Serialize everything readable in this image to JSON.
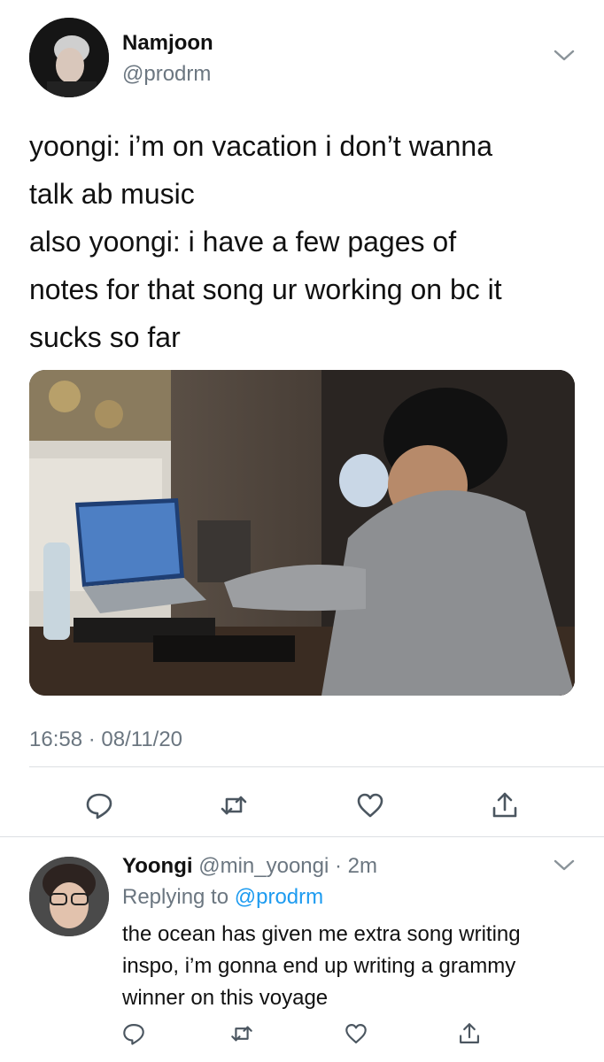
{
  "tweet": {
    "display_name": "Namjoon",
    "handle": "@prodrm",
    "text": "yoongi: i’m on vacation i don’t wanna\ntalk ab music\nalso yoongi: i have a few pages of\nnotes for that song ur working on bc it\nsucks so far",
    "timestamp": "16:58 · 08/11/20"
  },
  "reply": {
    "display_name": "Yoongi",
    "handle": "@min_yoongi",
    "separator": " · ",
    "age": "2m",
    "replying_prefix": "Replying to ",
    "replying_to": "@prodrm",
    "text": "the ocean has given me extra song writing\ninspo, i’m gonna end up writing a grammy\nwinner on this voyage"
  },
  "icons": {
    "reply": "reply-icon",
    "retweet": "retweet-icon",
    "like": "like-icon",
    "share": "share-icon",
    "more": "chevron-down-icon"
  },
  "colors": {
    "text": "#111111",
    "secondary": "#6b7680",
    "link": "#1d9bf0",
    "divider": "#dcdfe3"
  }
}
